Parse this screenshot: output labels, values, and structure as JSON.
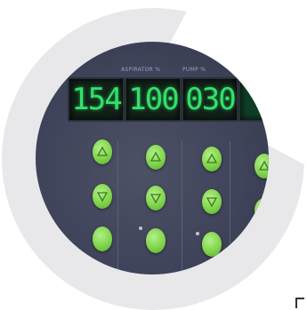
{
  "display": {
    "header_aspirator": "ASPIRATOR %",
    "header_pump": "PUMP %",
    "readout_1": "154",
    "readout_2": "100",
    "readout_3": "030"
  },
  "colors": {
    "lcd_green": "#33e06a",
    "button_green": "#7fd44a",
    "panel": "#40445a",
    "ring": "#e8e8ea"
  }
}
